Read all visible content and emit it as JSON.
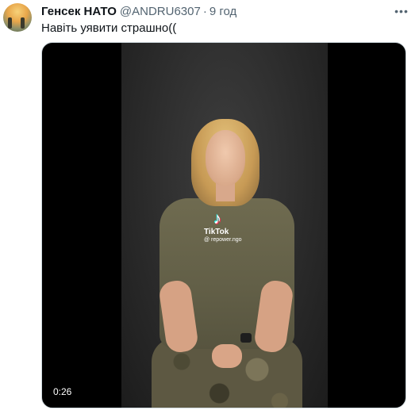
{
  "tweet": {
    "author_name": "Генсек НАТО",
    "author_handle": "@ANDRU6307",
    "separator": "·",
    "timestamp": "9 год",
    "more_icon": "more-horizontal-icon",
    "text": "Навіть уявити страшно(("
  },
  "video": {
    "duration": "0:26",
    "watermark_brand": "TikTok",
    "watermark_handle": "@ repower.ngo",
    "watermark_icon": "tiktok-logo-icon"
  }
}
